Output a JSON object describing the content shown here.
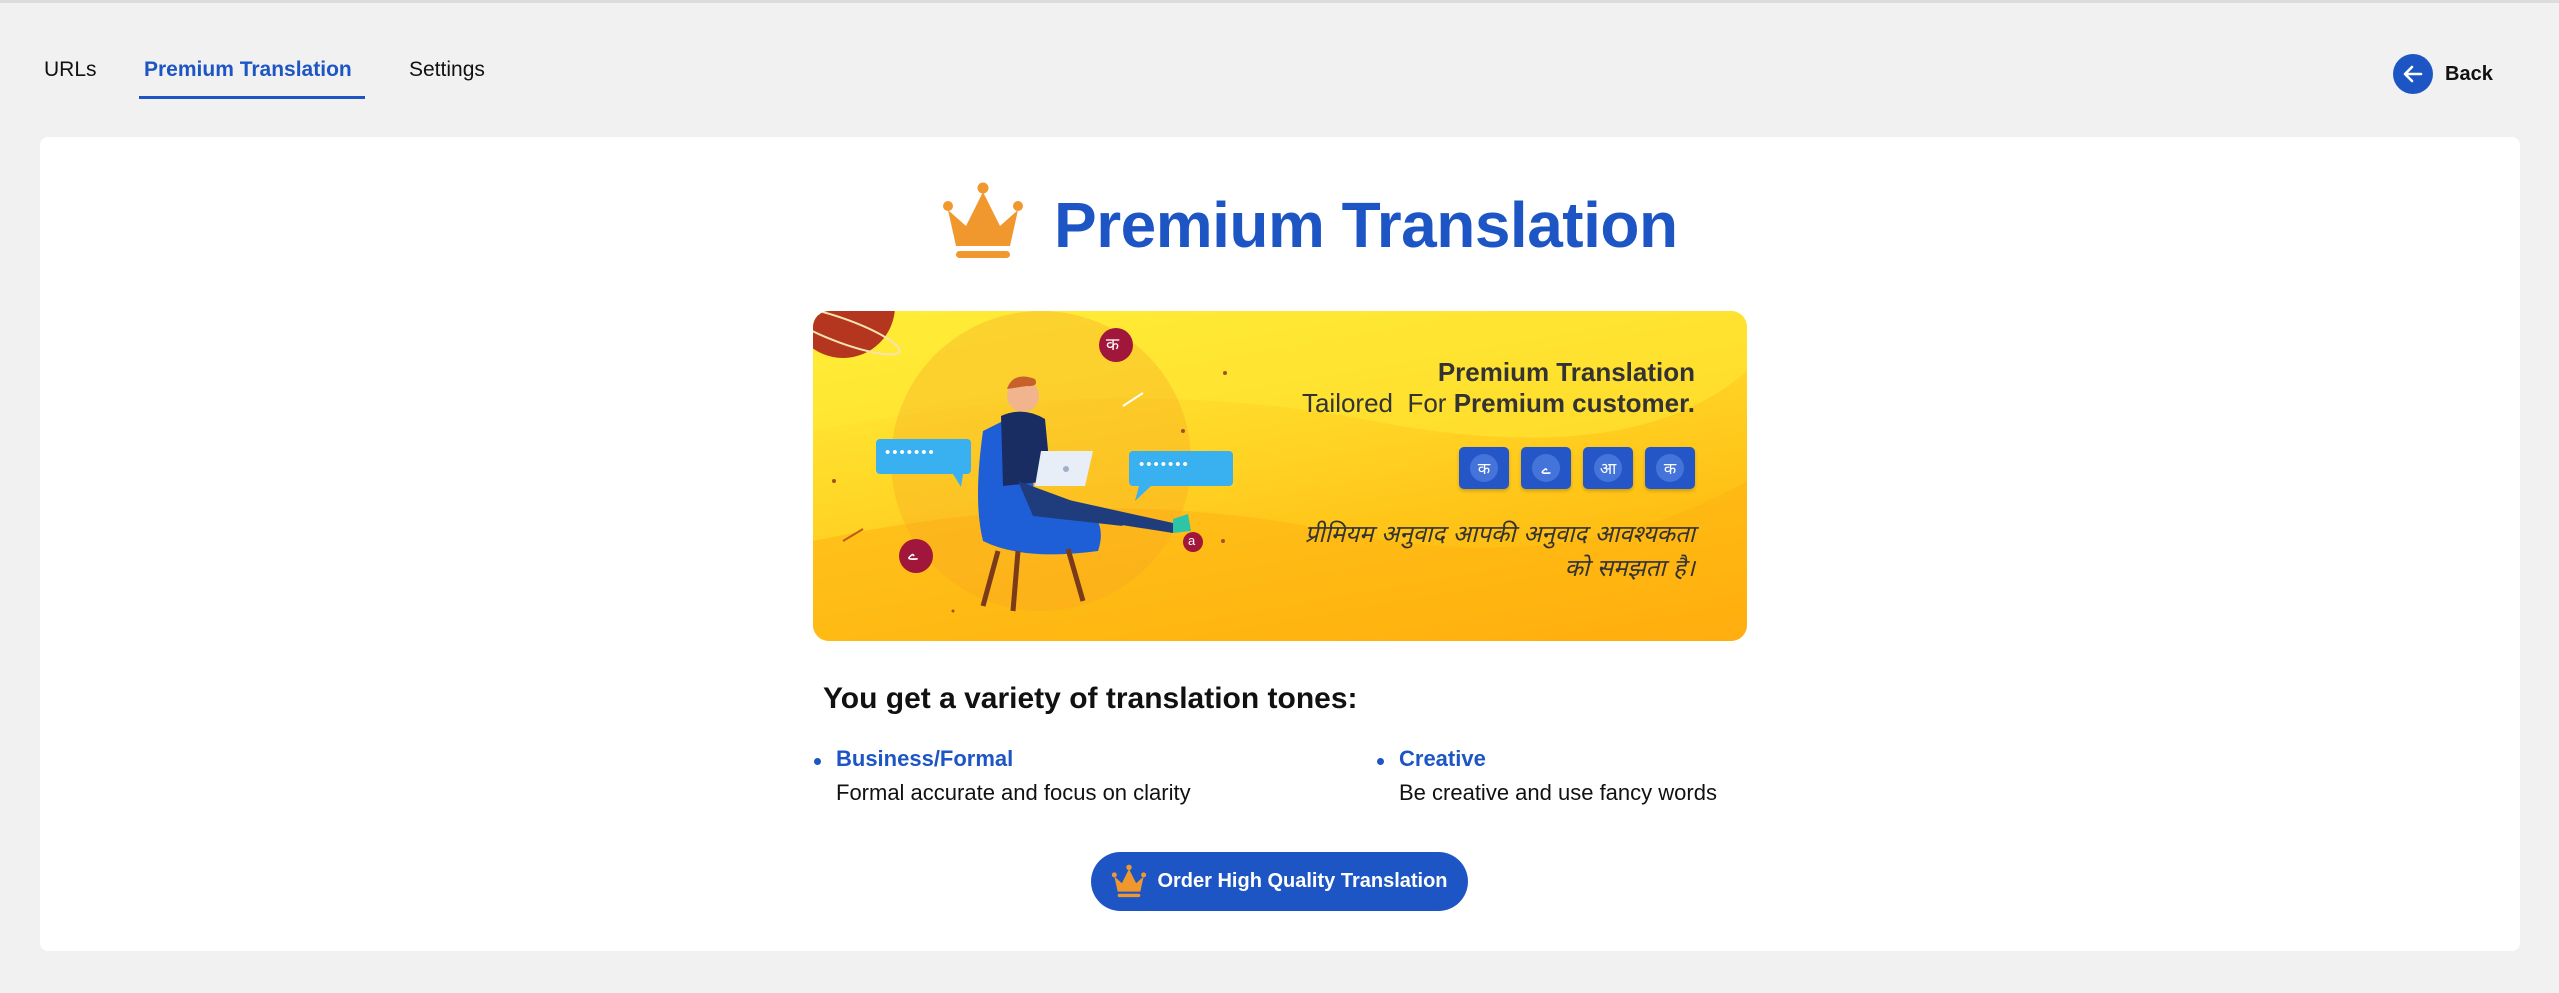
{
  "tabs": [
    {
      "label": "URLs"
    },
    {
      "label": "Premium Translation",
      "active": true
    },
    {
      "label": "Settings"
    }
  ],
  "back_label": "Back",
  "page_title": "Premium Translation",
  "banner": {
    "heading": "Premium Translation",
    "tagline_prefix": "Tailored  For ",
    "tagline_bold": "Premium customer.",
    "chips": [
      "क",
      "ے",
      "आ",
      "क"
    ],
    "hindi_text": "प्रीमियम अनुवाद आपकी अनुवाद आवश्यकता को समझता है।",
    "bubble_left": "•••••••",
    "bubble_right": "•••••••",
    "orb_top": "क",
    "orb_left": "ے",
    "orb_right": "a"
  },
  "subheading": "You get a variety of translation tones:",
  "features": [
    {
      "title": "Business/Formal",
      "description": "Formal accurate and focus on clarity"
    },
    {
      "title": "Creative",
      "description": "Be creative and use fancy words"
    }
  ],
  "order_button_label": "Order High Quality Translation",
  "colors": {
    "accent": "#1d56c4",
    "crown": "#f0972e",
    "page_bg": "#f1f1f1",
    "banner_yellow": "#ffd324"
  },
  "icons": {
    "crown": "crown-icon",
    "back": "arrow-left-icon"
  }
}
